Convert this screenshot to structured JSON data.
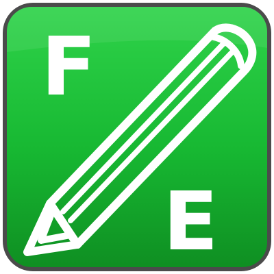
{
  "app_icon": {
    "name": "pencil-fe-icon",
    "letters": {
      "top": "F",
      "bottom": "E"
    },
    "colors": {
      "background": "#17b832",
      "background_dark": "#0f8f22",
      "background_light": "#2fd34a",
      "border": "#4b4b4b",
      "foreground": "#ffffff"
    }
  }
}
